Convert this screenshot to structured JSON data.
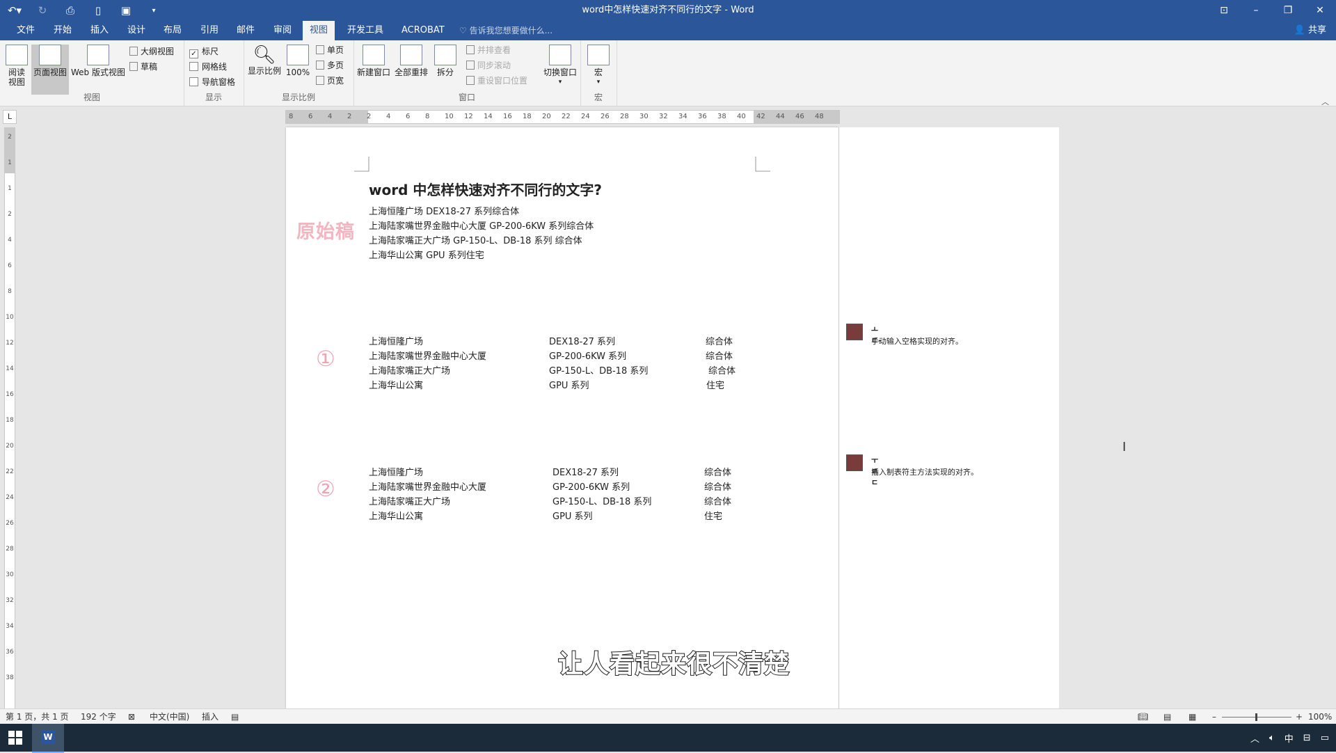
{
  "window": {
    "title": "word中怎样快速对齐不同行的文字 - Word"
  },
  "tabs": [
    {
      "label": "文件"
    },
    {
      "label": "开始"
    },
    {
      "label": "插入"
    },
    {
      "label": "设计"
    },
    {
      "label": "布局"
    },
    {
      "label": "引用"
    },
    {
      "label": "邮件"
    },
    {
      "label": "审阅"
    },
    {
      "label": "视图"
    },
    {
      "label": "开发工具"
    },
    {
      "label": "ACROBAT"
    }
  ],
  "tellme": "告诉我您想要做什么...",
  "share": "共享",
  "ribbon": {
    "views": {
      "read": "阅读\n视图",
      "print": "页面视图",
      "web": "Web 版式视图",
      "outline": "大纲视图",
      "draft": "草稿",
      "label": "视图"
    },
    "show": {
      "ruler": "标尺",
      "grid": "网格线",
      "nav": "导航窗格",
      "label": "显示"
    },
    "zoom": {
      "zoom": "显示比例",
      "pct": "100%",
      "one": "单页",
      "multi": "多页",
      "width": "页宽",
      "label": "显示比例"
    },
    "window": {
      "new": "新建窗口",
      "arrange": "全部重排",
      "split": "拆分",
      "side": "并排查看",
      "sync": "同步滚动",
      "reset": "重设窗口位置",
      "switch": "切换窗口",
      "label": "窗口"
    },
    "macro": {
      "macro": "宏",
      "label": "宏"
    }
  },
  "ruler": {
    "numbers": [
      "8",
      "6",
      "4",
      "2",
      "2",
      "4",
      "6",
      "8",
      "10",
      "12",
      "14",
      "16",
      "18",
      "20",
      "22",
      "24",
      "26",
      "28",
      "30",
      "32",
      "34",
      "36",
      "38",
      "40",
      "42",
      "44",
      "46",
      "48"
    ]
  },
  "vruler": {
    "numbers": [
      "2",
      "1",
      "1",
      "2",
      "4",
      "6",
      "8",
      "10",
      "12",
      "14",
      "16",
      "18",
      "20",
      "22",
      "24",
      "26",
      "28",
      "30",
      "32",
      "34",
      "36",
      "38"
    ]
  },
  "document": {
    "title": "word 中怎样快速对齐不同行的文字?",
    "stamp": "原始稿",
    "original": [
      "上海恒隆广场 DEX18-27 系列综合体",
      "上海陆家嘴世界金融中心大厦 GP-200-6KW 系列综合体",
      "上海陆家嘴正大广场 GP-150-L、DB-18 系列  综合体",
      "上海华山公寓 GPU 系列住宅"
    ],
    "marker1": "①",
    "table1": [
      [
        "上海恒隆广场",
        "DEX18-27 系列",
        "综合体"
      ],
      [
        "上海陆家嘴世界金融中心大厦",
        "GP-200-6KW 系列",
        "综合体"
      ],
      [
        "上海陆家嘴正大广场",
        "GP-150-L、DB-18 系列",
        "综合体"
      ],
      [
        "上海华山公寓",
        "GPU 系列",
        "住宅"
      ]
    ],
    "marker2": "②",
    "table2": [
      [
        "上海恒隆广场",
        "DEX18-27 系列",
        "综合体"
      ],
      [
        "上海陆家嘴世界金融中心大厦",
        "GP-200-6KW 系列",
        "综合体"
      ],
      [
        "上海陆家嘴正大广场",
        "GP-150-L、DB-18 系列",
        "综合体"
      ],
      [
        "上海华山公寓",
        "GPU 系列",
        "住宅"
      ]
    ]
  },
  "subtitle": "让人看起来很不清楚",
  "comments": [
    {
      "author": "ㅗ ㄷ-",
      "text": "手动输入空格实现的对齐。"
    },
    {
      "author": "ㅜ ㅌㄷ",
      "text": "插入制表符主方法实现的对齐。"
    }
  ],
  "status": {
    "page": "第 1 页，共 1 页",
    "words": "192 个字",
    "lang": "中文(中国)",
    "mode": "插入",
    "zoom": "100%"
  },
  "taskbar": {
    "word_icon": "W",
    "ime": "中"
  }
}
